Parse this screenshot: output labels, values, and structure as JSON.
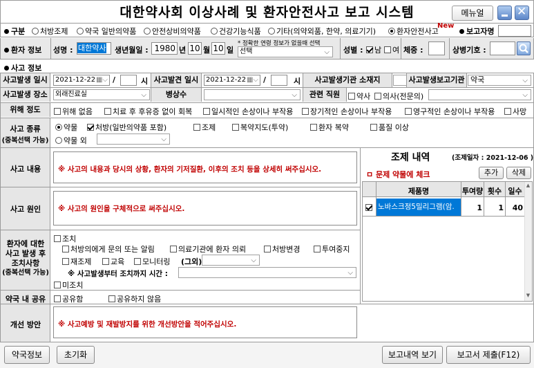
{
  "header": {
    "title": "대한약사회 이상사례 및 환자안전사고 보고 시스템",
    "menu_label": "메뉴얼"
  },
  "category": {
    "label": "구분",
    "options": [
      "처방조제",
      "약국 일반의약품",
      "안전상비의약품",
      "건강기능식품",
      "기타(의약외품, 한약, 의료기기)",
      "환자안전사고"
    ],
    "new_badge": "New",
    "reporter_label": "보고자명",
    "reporter_value": ""
  },
  "patient": {
    "label": "환자 정보",
    "name_label": "성명 :",
    "name_value": "대한약사",
    "birth_label": "생년월일 :",
    "birth_year": "1980",
    "year_unit": "년",
    "birth_month": "10",
    "month_unit": "월",
    "birth_day": "10",
    "day_unit": "일",
    "age_note": "* 정확한 연령 정보가 없을때 선택",
    "age_select": "선택",
    "sex_label": "성별 :",
    "male": "남",
    "female": "여",
    "weight_label": "체중 :",
    "weight_value": "",
    "disease_label": "상병기호 :",
    "disease_value": ""
  },
  "accident": {
    "section_label": "사고 정보",
    "occur_label": "사고발생 일시",
    "occur_date": "2021-12-22",
    "hour_unit": "시",
    "found_label": "사고발견 일시",
    "found_date": "2021-12-22",
    "org_label": "사고발생기관 소재지",
    "report_org_label": "사고발생보고기관",
    "report_org_value": "약국",
    "place_label": "사고발생 장소",
    "place_value": "외래진료실",
    "ward_label": "병상수",
    "staff_label": "관련 직원",
    "staff_pharmacist": "약사",
    "staff_doctor": "의사(전문의)"
  },
  "harm": {
    "label": "위해 정도",
    "options": [
      "위해 없음",
      "치료 후 후유증 없이 회복",
      "일시적인 손상이나 부작용",
      "장기적인 손상이나 부작용",
      "영구적인 손상이나 부작용",
      "사망"
    ]
  },
  "type": {
    "label1": "사고 종류",
    "label2": "(중복선택 가능)",
    "drug_label": "약물",
    "opts": [
      "처방(일반의약품 포함)",
      "조제",
      "복약지도(투약)",
      "환자 복약",
      "품질 이상"
    ],
    "other_label": "약물 외"
  },
  "content": {
    "label": "사고 내용",
    "hint": "※ 사고의 내용과 당시의 상황, 환자의 기저질환, 이후의 조치 등을 상세히 써주십시오."
  },
  "cause": {
    "label": "사고 원인",
    "hint": "※ 사고의 원인을 구체적으로 써주십시오."
  },
  "action": {
    "label1": "환자에 대한",
    "label2": "사고 발생 후",
    "label3": "조치사항",
    "label4": "(중복선택 가능)",
    "taken": "조치",
    "opts_row1": [
      "처방의에게 문의 또는 알림",
      "의료기관에 환자 의뢰",
      "처방변경",
      "투여중지"
    ],
    "opts_row2": [
      "재조제",
      "교육",
      "모니터링"
    ],
    "other": "(그외)",
    "time_label": "※ 사고발생부터 조치까지 시간 :",
    "not_taken": "미조치"
  },
  "share": {
    "label": "약국 내 공유",
    "yes": "공유함",
    "no": "공유하지 않음"
  },
  "improve": {
    "label": "개선 방안",
    "hint": "※ 사고예방 및 재발방지를 위한 개선방안을 적어주십시오."
  },
  "rx": {
    "title": "조제 내역",
    "date_text": "(조제일자 : 2021-12-06 )",
    "problem_label": "ㅁ 문제 약물에 체크",
    "add": "추가",
    "del": "삭제",
    "headers": [
      "제품명",
      "투여량",
      "횟수",
      "일수"
    ],
    "rows": [
      {
        "name": "노바스크정5밀리그램(암.",
        "dose": "1",
        "freq": "1",
        "days": "40"
      }
    ]
  },
  "footer": {
    "pharmacy_info": "약국정보",
    "reset": "초기화",
    "view_reports": "보고내역 보기",
    "submit": "보고서 제출(F12)"
  },
  "colors": {
    "accent_blue": "#0078d7",
    "hint_red": "#c00000"
  }
}
